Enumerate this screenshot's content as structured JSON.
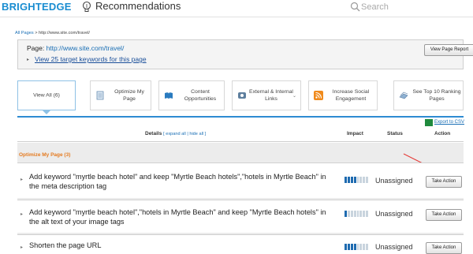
{
  "header": {
    "brand": "BRIGHTEDGE",
    "nav_title": "Recommendations",
    "search_placeholder": "Search",
    "icons": {
      "nav": "lightbulb-icon",
      "search": "search-icon"
    }
  },
  "breadcrumb": {
    "root": "All Pages",
    "separator": " > ",
    "current": "http://www.site.com/travel/"
  },
  "page_box": {
    "page_label": "Page: ",
    "page_url": "http://www.site.com/travel/",
    "keywords_link": "View 25 target keywords for this page",
    "report_button": "View Page Report"
  },
  "tabs": [
    {
      "label": "View All (6)",
      "icon": "none",
      "active": true
    },
    {
      "label": "Optimize My Page",
      "icon": "document-icon",
      "active": false
    },
    {
      "label": "Content Opportunities",
      "icon": "book-icon",
      "active": false
    },
    {
      "label": "External & Internal Links",
      "icon": "link-icon",
      "active": false
    },
    {
      "label": "Increase Social Engagement",
      "icon": "rss-icon",
      "active": false
    },
    {
      "label": "See Top 10 Ranking Pages",
      "icon": "pages-icon",
      "active": false
    }
  ],
  "table": {
    "export_link": "Export to CSV",
    "columns": {
      "details": "Details",
      "expand_all": "expand all",
      "hide_all": "hide all",
      "impact": "Impact",
      "status": "Status",
      "action": "Action"
    },
    "section_title": "Optimize My Page (3)",
    "rows": [
      {
        "text": "Add keyword \"myrtle beach hotel\" and keep \"Myrtle Beach hotels\",\"hotels in Myrtle Beach\" in the meta description tag",
        "impact": 0.5,
        "status": "Unassigned",
        "action": "Take Action"
      },
      {
        "text": "Add keyword \"myrtle beach hotel\",\"hotels in Myrtle Beach\" and keep \"Myrtle Beach hotels\" in the alt text of your image tags",
        "impact": 0.125,
        "status": "Unassigned",
        "action": "Take Action"
      },
      {
        "text": "Shorten the page URL",
        "impact": 0.5,
        "status": "Unassigned",
        "action": "Take Action"
      }
    ]
  },
  "colors": {
    "brand": "#1a8dd1",
    "accent": "#2e8bd2",
    "section_title": "#e47a1f",
    "annotation": "#e53935"
  }
}
